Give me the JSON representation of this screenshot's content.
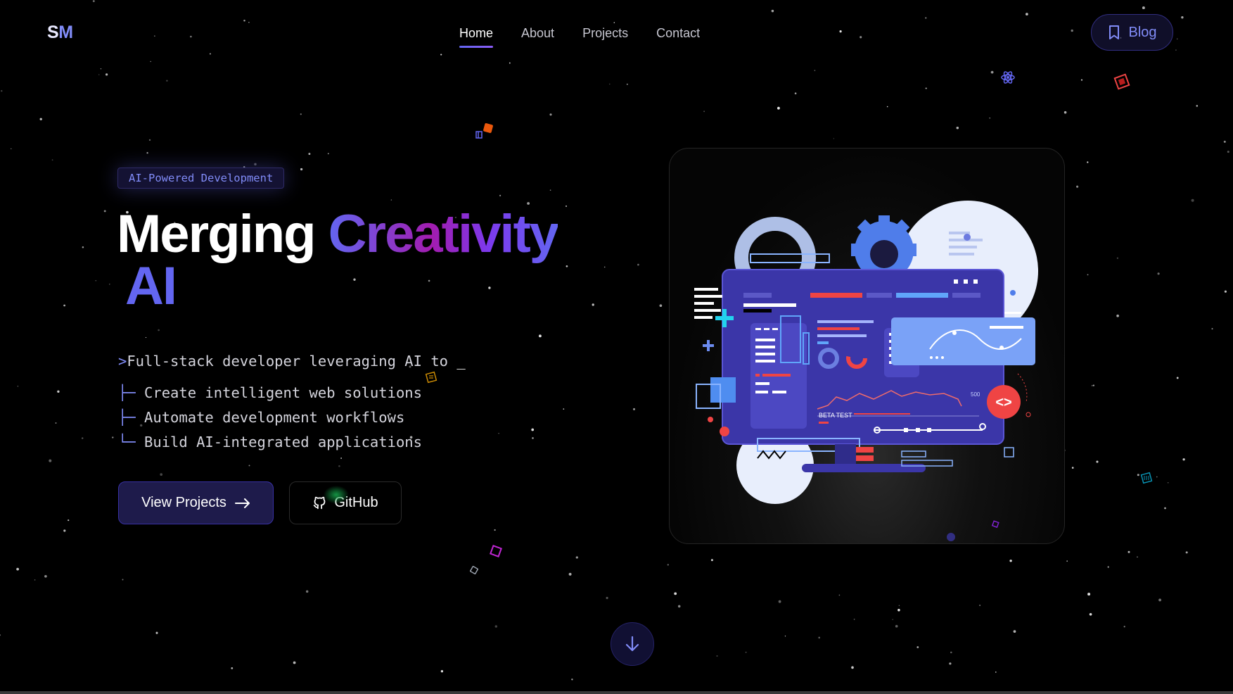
{
  "logo": {
    "s": "S",
    "m": "M"
  },
  "nav": {
    "items": [
      {
        "label": "Home",
        "active": true
      },
      {
        "label": "About",
        "active": false
      },
      {
        "label": "Projects",
        "active": false
      },
      {
        "label": "Contact",
        "active": false
      }
    ]
  },
  "blog": {
    "label": "Blog",
    "icon": "bookmark-icon"
  },
  "hero": {
    "badge": "AI-Powered Development",
    "headline_white": "Merging",
    "headline_gradient": "Creativity",
    "headline_ai": "AI",
    "terminal": {
      "prompt": ">",
      "text": "Full-stack developer leveraging AI to",
      "cursor": "_",
      "items": [
        {
          "branch": "├─",
          "text": "Create intelligent web solutions"
        },
        {
          "branch": "├─",
          "text": "Automate development workflows"
        },
        {
          "branch": "└─",
          "text": "Build AI-integrated applications"
        }
      ]
    },
    "buttons": {
      "primary": "View Projects",
      "primary_icon": "arrow-right-icon",
      "secondary": "GitHub",
      "secondary_icon": "github-icon"
    }
  },
  "illustration": {
    "beta_label": "BETA TEST",
    "value_label": "500",
    "code_badge": "<>"
  },
  "scroll": {
    "icon": "arrow-down-icon"
  },
  "colors": {
    "accent": "#6366f1",
    "accent_light": "#818cf8",
    "gradient_mid": "#a21caf",
    "background": "#000000"
  }
}
